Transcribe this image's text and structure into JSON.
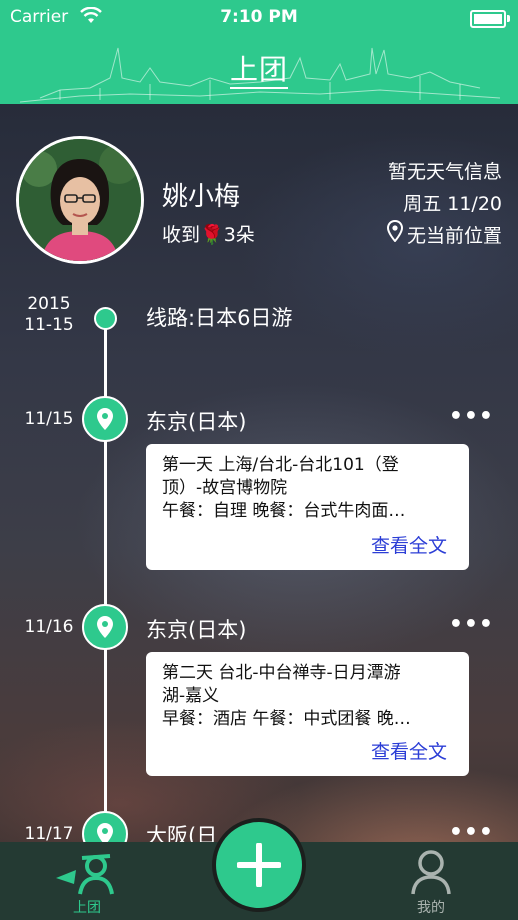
{
  "status_bar": {
    "carrier": "Carrier",
    "time": "7:10 PM"
  },
  "nav": {
    "title": "上团"
  },
  "profile": {
    "name": "姚小梅",
    "received_prefix": "收到",
    "received_suffix": "3朵"
  },
  "weather": {
    "status": "暂无天气信息",
    "date": "周五 11/20",
    "location": "无当前位置"
  },
  "timeline": {
    "start_year": "2015",
    "start_date": "11-15",
    "route": "线路:日本6日游",
    "items": [
      {
        "date": "11/15",
        "city": "东京(日本)",
        "line1": "第一天 上海/台北-台北101（登",
        "line2": "顶）-故宫博物院",
        "line3": "午餐：自理 晚餐：台式牛肉面…",
        "read_more": "查看全文"
      },
      {
        "date": "11/16",
        "city": "东京(日本)",
        "line1": "第二天 台北-中台禅寺-日月潭游",
        "line2": "湖-嘉义",
        "line3": "早餐：酒店 午餐：中式团餐 晚…",
        "read_more": "查看全文"
      },
      {
        "date": "11/17",
        "city": "大阪(日"
      }
    ]
  },
  "tabbar": {
    "tab1": "上团",
    "tab2": "我的"
  },
  "colors": {
    "accent": "#2ec98d",
    "tabbar": "#243a33",
    "link": "#2c3ed6"
  }
}
